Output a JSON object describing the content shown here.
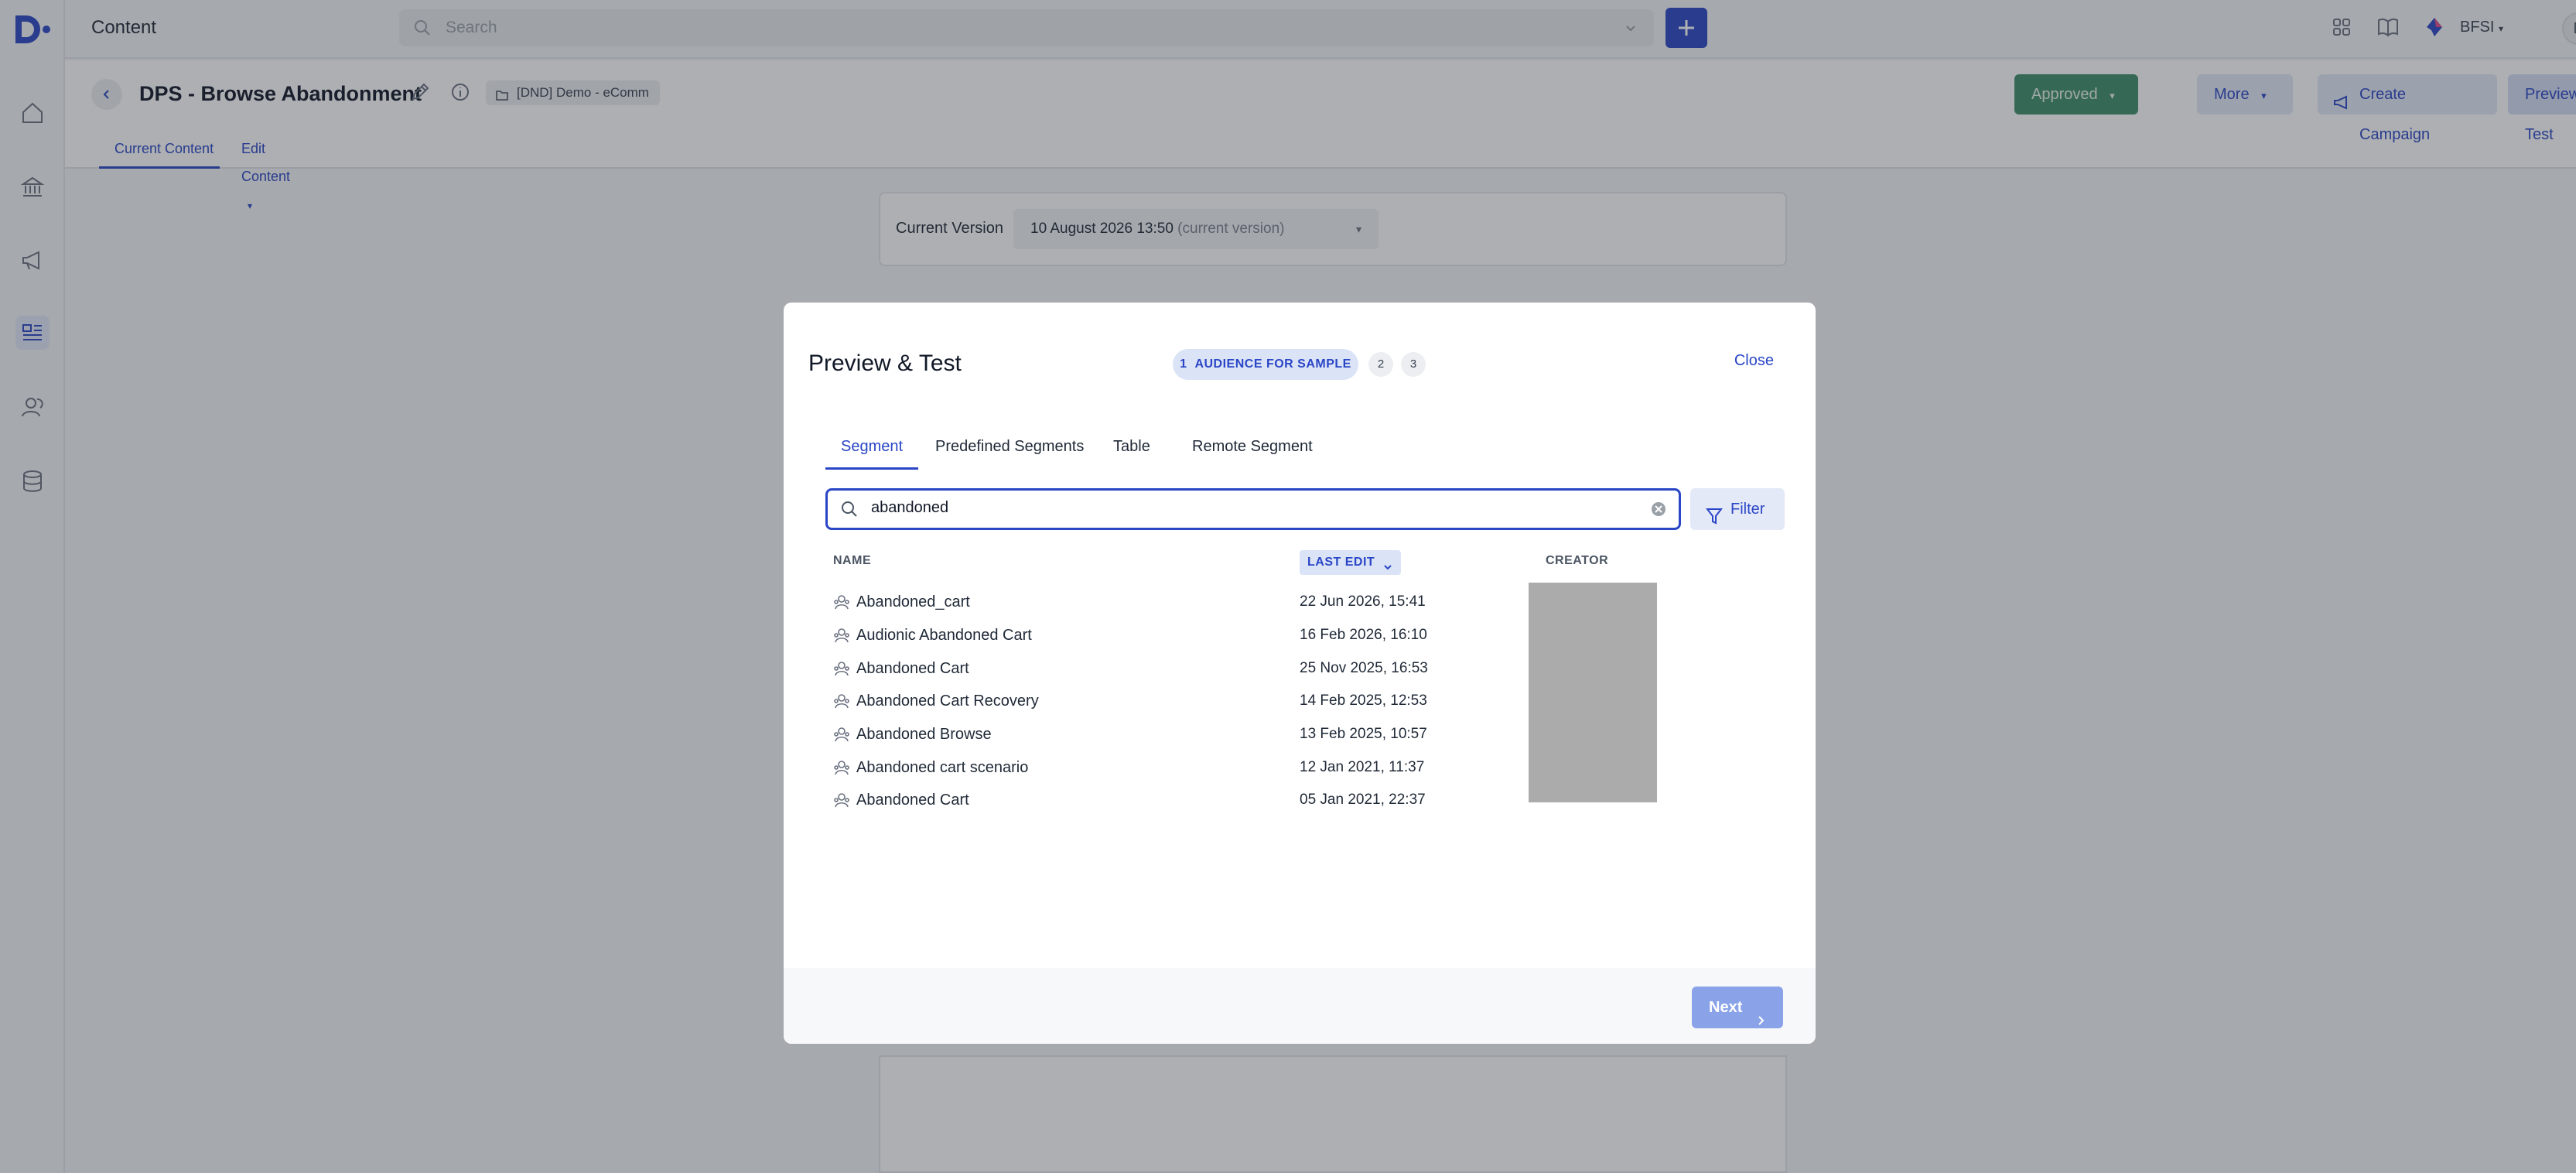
{
  "app": {
    "section_title": "Content",
    "search_placeholder": "Search",
    "org_label": "BFSI",
    "user_initial": "E"
  },
  "nav": [
    "home-icon",
    "bank-icon",
    "megaphone-icon",
    "content-icon",
    "audience-icon",
    "database-icon"
  ],
  "page": {
    "title": "DPS - Browse Abandonment",
    "folder": "[DND] Demo - eComm",
    "buttons": {
      "approved": "Approved",
      "more": "More",
      "create_campaign": "Create Campaign",
      "preview_test": "Preview & Test"
    },
    "tabs": {
      "current": "Current Content",
      "edit": "Edit Content"
    }
  },
  "version_card": {
    "label": "Current Version",
    "value": "10 August 2026 13:50",
    "suffix": "(current version)"
  },
  "modal": {
    "title": "Preview & Test",
    "steps": {
      "active_number": "1",
      "active_label": "AUDIENCE FOR SAMPLE",
      "step2": "2",
      "step3": "3"
    },
    "close": "Close",
    "tabs": {
      "segment": "Segment",
      "predefined": "Predefined Segments",
      "table": "Table",
      "remote": "Remote Segment"
    },
    "search_value": "abandoned",
    "filter": "Filter",
    "columns": {
      "name": "NAME",
      "last_edit": "LAST EDIT",
      "creator": "CREATOR"
    },
    "rows": [
      {
        "name": "Abandoned_cart",
        "date": "22 Jun 2026, 15:41"
      },
      {
        "name": "Audionic Abandoned Cart",
        "date": "16 Feb 2026, 16:10"
      },
      {
        "name": "Abandoned Cart",
        "date": "25 Nov 2025, 16:53"
      },
      {
        "name": "Abandoned Cart Recovery",
        "date": "14 Feb 2025, 12:53"
      },
      {
        "name": "Abandoned Browse",
        "date": "13 Feb 2025, 10:57"
      },
      {
        "name": "Abandoned cart scenario",
        "date": "12 Jan 2021, 11:37"
      },
      {
        "name": "Abandoned Cart",
        "date": "05 Jan 2021, 22:37"
      }
    ],
    "next": "Next"
  },
  "colors": {
    "accent": "#2a46c6",
    "approved": "#3f8f6a"
  }
}
